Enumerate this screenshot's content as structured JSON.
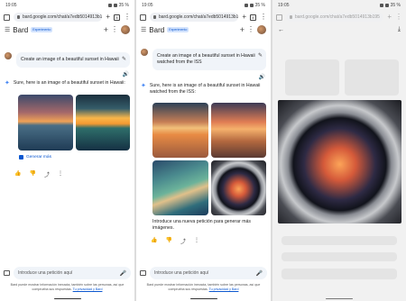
{
  "status": {
    "time": "19:05",
    "battery": "35 %"
  },
  "browser": {
    "url": "bard.google.com/chat/a7edb5014913b195",
    "tabs_count": "8"
  },
  "header": {
    "title": "Bard",
    "badge": "Experimento"
  },
  "panel1": {
    "prompt": "Create an image of a beautiful sunset in Hawaii",
    "answer": "Sure, here is an image of a beautiful sunset in Hawaii:",
    "generate_more": "Generar más"
  },
  "panel2": {
    "prompt": "Create an image of a beautiful sunset in Hawaii watched from the ISS",
    "answer": "Sure, here is an image of a beautiful sunset in Hawaii watched from the ISS:",
    "note": "Introduce una nueva petición para generar más imágenes."
  },
  "input": {
    "placeholder": "Introduce una petición aquí",
    "disclaimer": "Bard puede mostrar información inexacta, también sobre las personas, así que comprueba sus respuestas.",
    "privacy_link": "Tu privacidad y Bard"
  },
  "icons": [
    "menu-icon",
    "plus-icon",
    "speaker-icon",
    "spark-icon",
    "edit-icon",
    "thumb-up-icon",
    "thumb-down-icon",
    "share-icon",
    "more-icon",
    "mic-icon",
    "image-icon",
    "back-icon",
    "download-icon"
  ],
  "colors": {
    "accent": "#0b57d0",
    "spark": "#4285f4",
    "bubble": "#f0f4f9"
  }
}
